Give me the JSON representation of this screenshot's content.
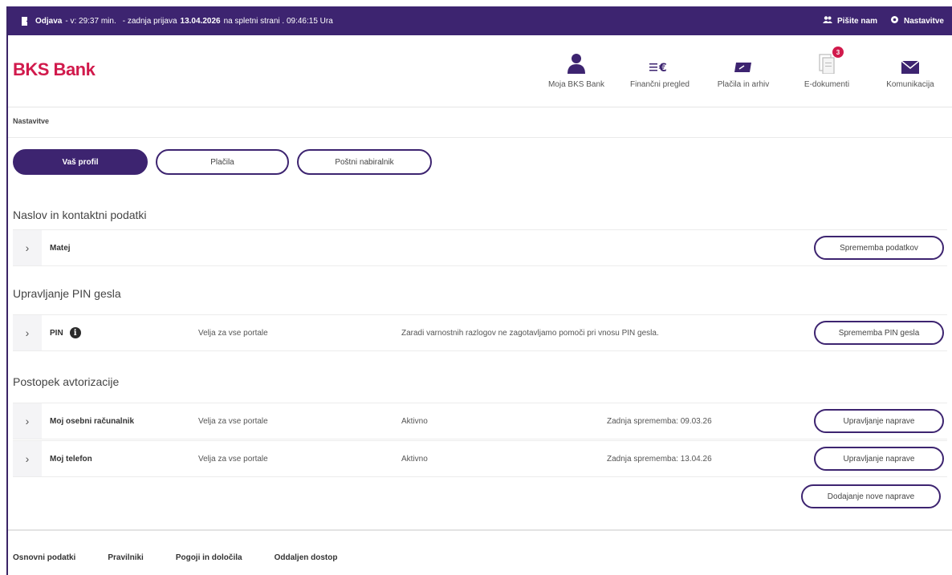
{
  "topbar": {
    "logout_label": "Odjava",
    "session_text": "- v: 29:37 min.",
    "last_login_prefix": "- zadnja prijava",
    "last_login_date": "13.04.2026",
    "last_login_suffix": "na spletni strani . 09:46:15 Ura",
    "write_us": "Pišite nam",
    "settings": "Nastavitve"
  },
  "logo": "BKS Bank",
  "nav": [
    {
      "label": "Moja BKS Bank",
      "icon": "user-icon"
    },
    {
      "label": "Finančni pregled",
      "icon": "finance-icon"
    },
    {
      "label": "Plačila in arhiv",
      "icon": "payments-icon"
    },
    {
      "label": "E-dokumenti",
      "icon": "documents-icon",
      "badge": "3"
    },
    {
      "label": "Komunikacija",
      "icon": "mail-icon"
    }
  ],
  "breadcrumb": "Nastavitve",
  "tabs": [
    {
      "label": "Vaš profil",
      "active": true
    },
    {
      "label": "Plačila",
      "active": false
    },
    {
      "label": "Poštni nabiralnik",
      "active": false
    }
  ],
  "sections": {
    "address": {
      "title": "Naslov in kontaktni podatki",
      "name": "Matej",
      "button": "Sprememba podatkov"
    },
    "pin": {
      "title": "Upravljanje PIN gesla",
      "name": "PIN",
      "validity": "Velja za vse portale",
      "note": "Zaradi varnostnih razlogov ne zagotavljamo pomoči pri vnosu PIN gesla.",
      "button": "Sprememba PIN gesla"
    },
    "auth": {
      "title": "Postopek avtorizacije",
      "devices": [
        {
          "name": "Moj osebni računalnik",
          "validity": "Velja za vse portale",
          "status": "Aktivno",
          "last_change": "Zadnja sprememba: 09.03.26",
          "button": "Upravljanje naprave"
        },
        {
          "name": "Moj telefon",
          "validity": "Velja za vse portale",
          "status": "Aktivno",
          "last_change": "Zadnja sprememba: 13.04.26",
          "button": "Upravljanje naprave"
        }
      ],
      "add_button": "Dodajanje nove naprave"
    }
  },
  "footer": [
    "Osnovni podatki",
    "Pravilniki",
    "Pogoji in določila",
    "Oddaljen dostop"
  ],
  "colors": {
    "primary": "#3d2470",
    "brand": "#d11a4c"
  }
}
